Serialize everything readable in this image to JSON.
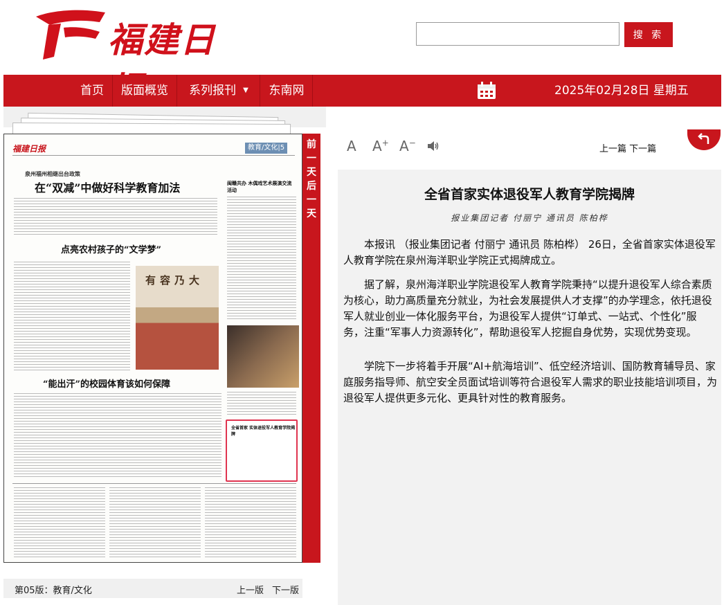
{
  "header": {
    "logo_text": "福建日报",
    "search": {
      "placeholder": "",
      "button_label": "搜 索"
    }
  },
  "nav": {
    "items": [
      "首页",
      "版面概览",
      "系列报刊",
      "东南网"
    ],
    "date": "2025年02月28日 星期五"
  },
  "paper": {
    "side_tab": "前一天后一天",
    "mini": {
      "logo": "福建日报",
      "section": "教育/文化|5",
      "sub": "泉州福州相继出台政策",
      "h1": "在“双减”中做好科学教育加法",
      "h2": "点亮农村孩子的“文学梦”",
      "h3": "“能出汗”的校园体育该如何保障",
      "photo_text": "有容乃大",
      "right_title": "闽赣共办 木偶戏艺术展演交流活动",
      "highlight": "全省首家 实体退役军人教育学院揭牌"
    },
    "footer": {
      "page_label": "第05版：教育/文化",
      "prev": "上一版",
      "next": "下一版"
    }
  },
  "toolbar": {
    "font_normal": "A",
    "font_up": "A",
    "font_down": "A",
    "prev_article": "上一篇",
    "next_article": "下一篇"
  },
  "article": {
    "title": "全省首家实体退役军人教育学院揭牌",
    "byline": "报业集团记者 付丽宁 通讯员 陈柏桦",
    "paragraphs": [
      "本报讯 （报业集团记者 付丽宁 通讯员 陈柏桦） 26日，全省首家实体退役军人教育学院在泉州海洋职业学院正式揭牌成立。",
      "据了解，泉州海洋职业学院退役军人教育学院秉持“以提升退役军人综合素质为核心，助力高质量充分就业，为社会发展提供人才支撑”的办学理念，依托退役军人就业创业一体化服务平台，为退役军人提供“订单式、一站式、个性化”服务，注重“军事人力资源转化”，帮助退役军人挖掘自身优势，实现优势变现。",
      "学院下一步将着手开展“AI+航海培训”、低空经济培训、国防教育辅导员、家庭服务指导师、航空安全员面试培训等符合退役军人需求的职业技能培训项目，为退役军人提供更多元化、更具针对性的教育服务。"
    ]
  },
  "colors": {
    "brand_red": "#c8161d",
    "panel_grey": "#f2f2f2"
  }
}
